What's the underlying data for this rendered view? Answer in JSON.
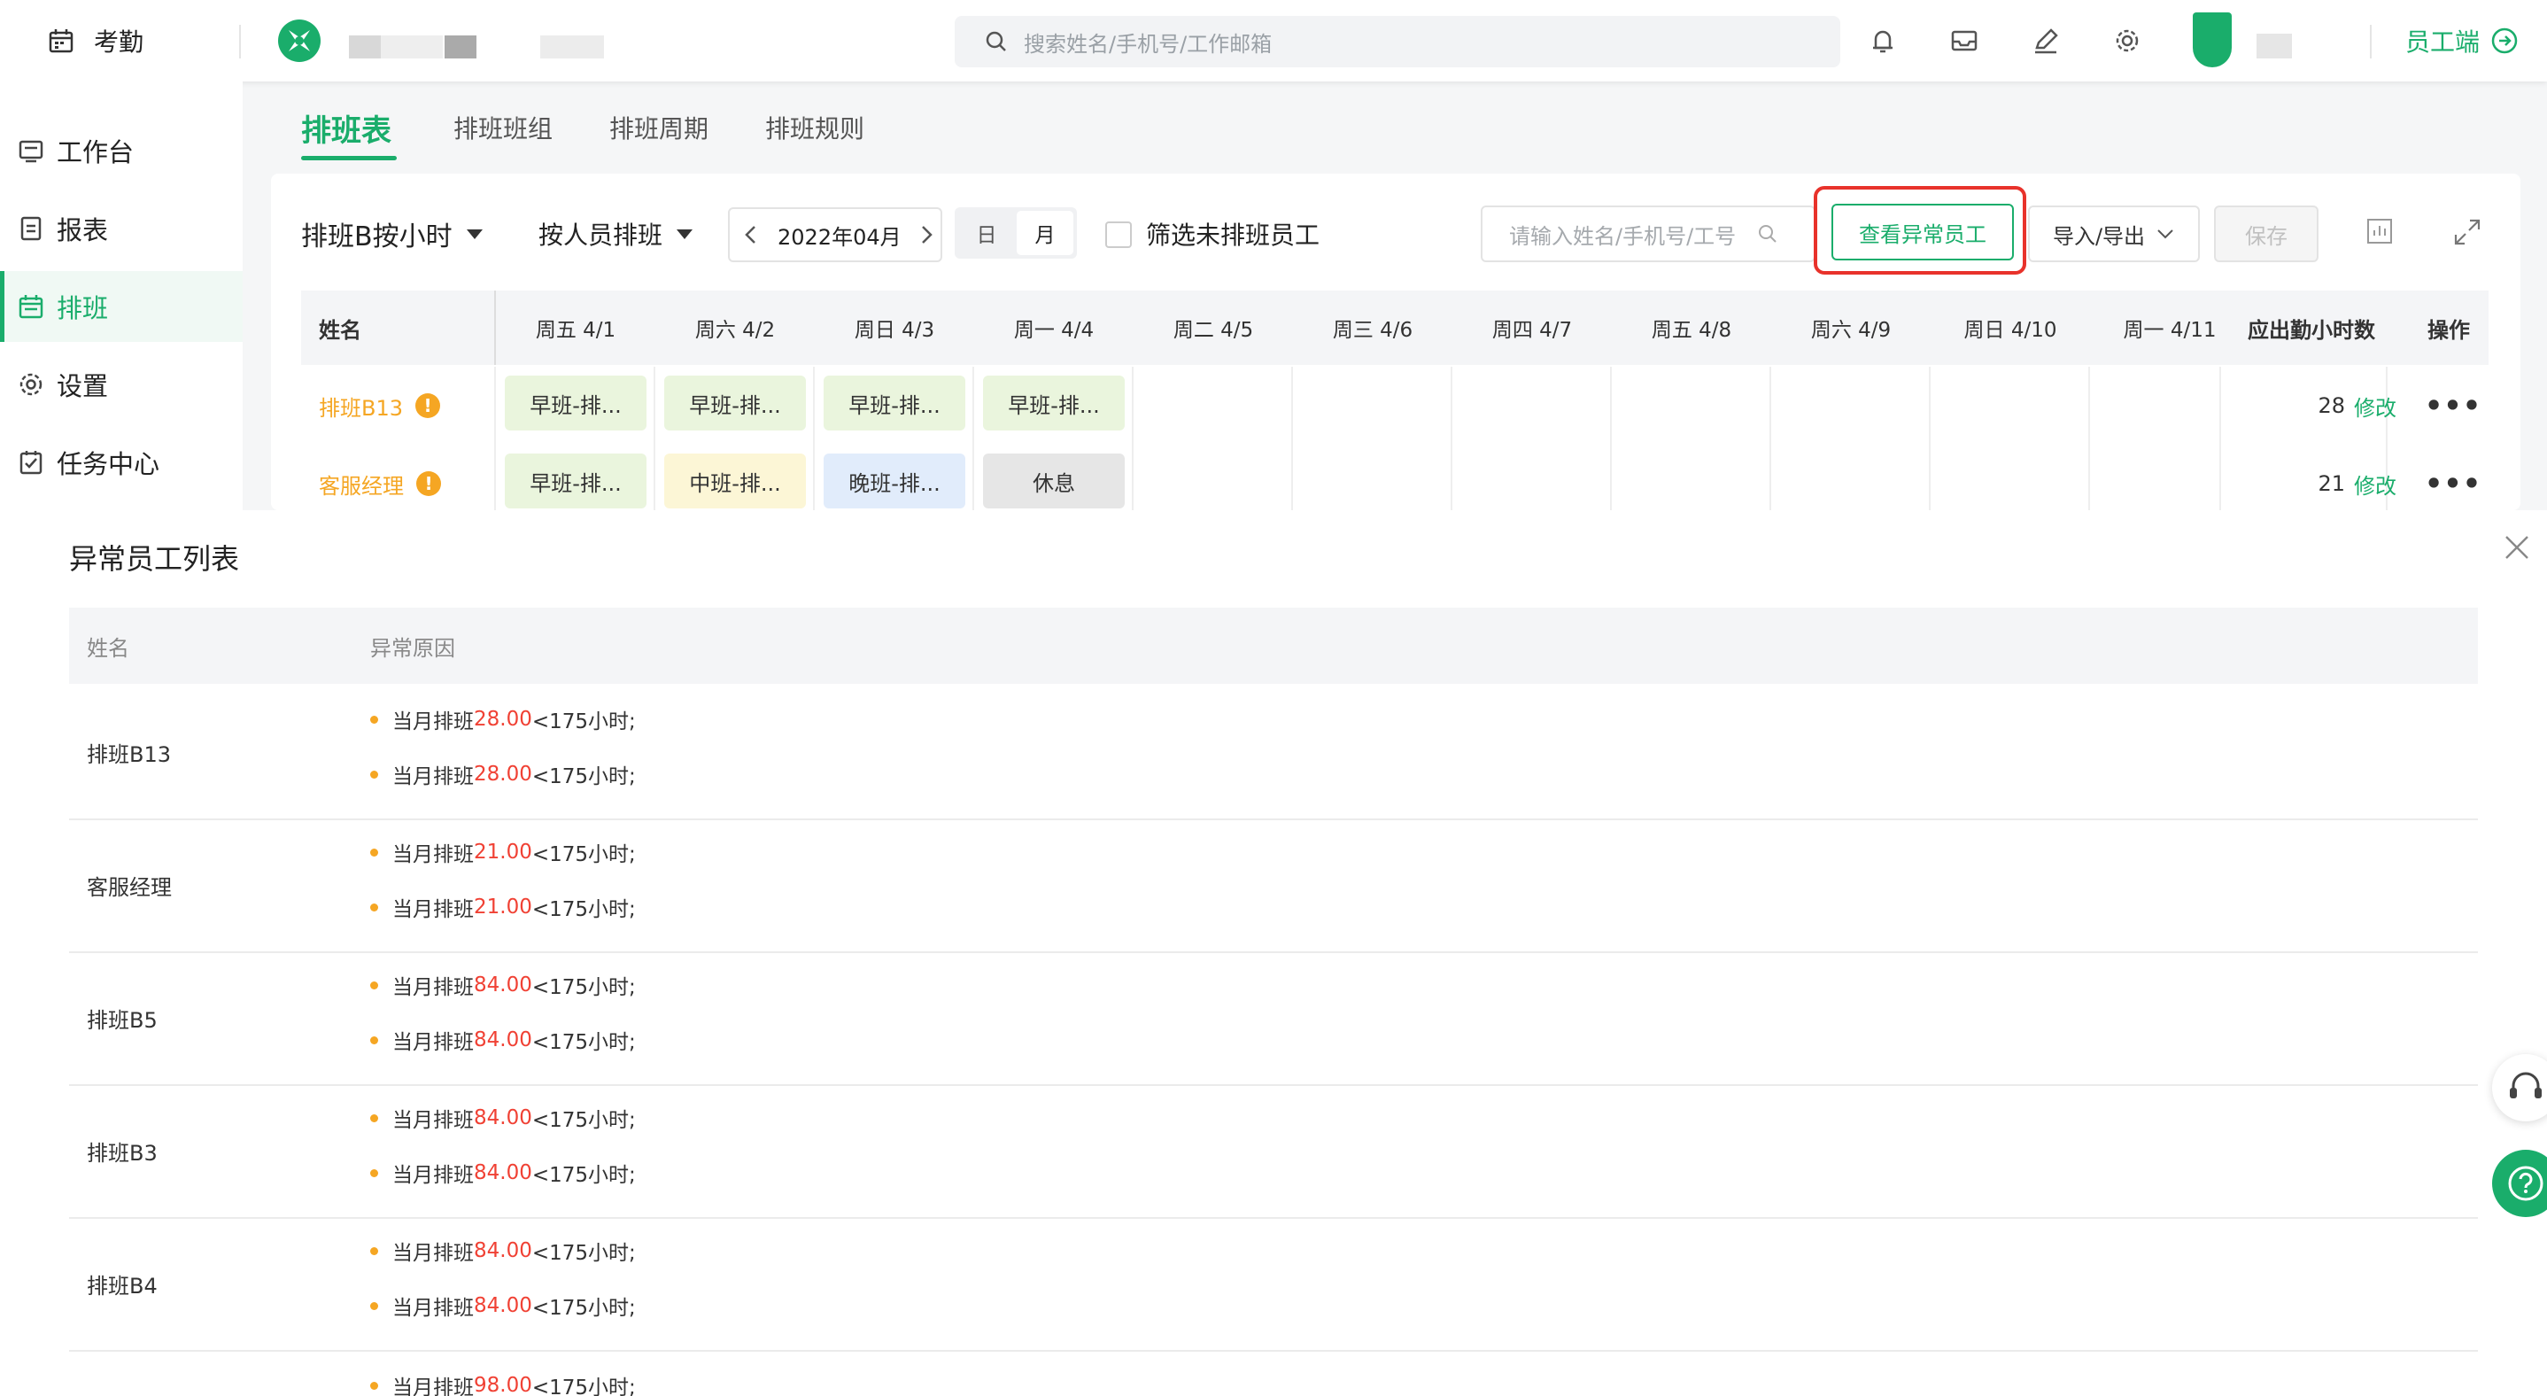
{
  "topbar": {
    "app_title": "考勤",
    "search_placeholder": "搜索姓名/手机号/工作邮箱",
    "employee_switch_label": "员工端"
  },
  "sidebar": {
    "items": [
      {
        "label": "工作台",
        "icon": "dashboard-icon"
      },
      {
        "label": "报表",
        "icon": "report-icon"
      },
      {
        "label": "排班",
        "icon": "calendar-icon"
      },
      {
        "label": "设置",
        "icon": "gear-icon"
      },
      {
        "label": "任务中心",
        "icon": "task-icon"
      }
    ]
  },
  "tabs": [
    "排班表",
    "排班班组",
    "排班周期",
    "排班规则"
  ],
  "toolbar": {
    "group_select": "排班B按小时",
    "mode_select": "按人员排班",
    "month": "2022年04月",
    "view_day": "日",
    "view_month": "月",
    "filter_unscheduled": "筛选未排班员工",
    "staff_search_placeholder": "请输入姓名/手机号/工号",
    "abnormal_button": "查看异常员工",
    "import_export": "导入/导出",
    "save": "保存"
  },
  "schedule_table": {
    "name_header": "姓名",
    "day_headers": [
      "周五 4/1",
      "周六 4/2",
      "周日 4/3",
      "周一 4/4",
      "周二 4/5",
      "周三 4/6",
      "周四 4/7",
      "周五 4/8",
      "周六 4/9",
      "周日 4/10",
      "周一 4/11"
    ],
    "hours_header": "应出勤小时数",
    "action_header": "操作",
    "edit_label": "修改",
    "rows": [
      {
        "name": "排班B13",
        "hours": "28",
        "shifts": [
          "早班-排...",
          "早班-排...",
          "早班-排...",
          "早班-排..."
        ]
      },
      {
        "name": "客服经理",
        "hours": "21",
        "shifts": [
          "早班-排...",
          "中班-排...",
          "晚班-排...",
          "休息"
        ]
      }
    ]
  },
  "drawer": {
    "title": "异常员工列表",
    "col_name": "姓名",
    "col_reason": "异常原因",
    "rows": [
      {
        "name": "排班B13",
        "reasons": [
          {
            "prefix": "当月排班",
            "value": "28.00",
            "suffix": "<175小时;"
          },
          {
            "prefix": "当月排班",
            "value": "28.00",
            "suffix": "<175小时;"
          }
        ]
      },
      {
        "name": "客服经理",
        "reasons": [
          {
            "prefix": "当月排班",
            "value": "21.00",
            "suffix": "<175小时;"
          },
          {
            "prefix": "当月排班",
            "value": "21.00",
            "suffix": "<175小时;"
          }
        ]
      },
      {
        "name": "排班B5",
        "reasons": [
          {
            "prefix": "当月排班",
            "value": "84.00",
            "suffix": "<175小时;"
          },
          {
            "prefix": "当月排班",
            "value": "84.00",
            "suffix": "<175小时;"
          }
        ]
      },
      {
        "name": "排班B3",
        "reasons": [
          {
            "prefix": "当月排班",
            "value": "84.00",
            "suffix": "<175小时;"
          },
          {
            "prefix": "当月排班",
            "value": "84.00",
            "suffix": "<175小时;"
          }
        ]
      },
      {
        "name": "排班B4",
        "reasons": [
          {
            "prefix": "当月排班",
            "value": "84.00",
            "suffix": "<175小时;"
          },
          {
            "prefix": "当月排班",
            "value": "84.00",
            "suffix": "<175小时;"
          }
        ]
      },
      {
        "name": "",
        "reasons": [
          {
            "prefix": "当月排班",
            "value": "98.00",
            "suffix": "<175小时;"
          }
        ]
      }
    ]
  },
  "colors": {
    "accent": "#1aad6b",
    "warning": "#f5a623",
    "danger": "#f04134",
    "highlight_border": "#e8322b"
  }
}
